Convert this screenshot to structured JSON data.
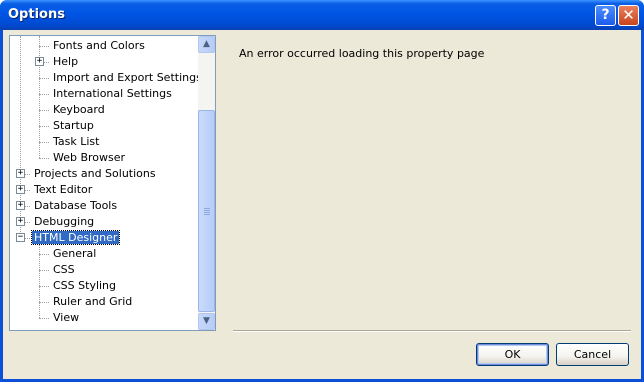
{
  "window": {
    "title": "Options",
    "help_glyph": "?",
    "close_glyph": "✕"
  },
  "tree": {
    "items": [
      {
        "label": "Fonts and Colors",
        "level": 2,
        "expander": null
      },
      {
        "label": "Help",
        "level": 2,
        "expander": "+"
      },
      {
        "label": "Import and Export Settings",
        "level": 2,
        "expander": null
      },
      {
        "label": "International Settings",
        "level": 2,
        "expander": null
      },
      {
        "label": "Keyboard",
        "level": 2,
        "expander": null
      },
      {
        "label": "Startup",
        "level": 2,
        "expander": null
      },
      {
        "label": "Task List",
        "level": 2,
        "expander": null
      },
      {
        "label": "Web Browser",
        "level": 2,
        "expander": null
      },
      {
        "label": "Projects and Solutions",
        "level": 1,
        "expander": "+"
      },
      {
        "label": "Text Editor",
        "level": 1,
        "expander": "+"
      },
      {
        "label": "Database Tools",
        "level": 1,
        "expander": "+"
      },
      {
        "label": "Debugging",
        "level": 1,
        "expander": "+"
      },
      {
        "label": "HTML Designer",
        "level": 1,
        "expander": "−",
        "selected": true
      },
      {
        "label": "General",
        "level": 2,
        "expander": null
      },
      {
        "label": "CSS",
        "level": 2,
        "expander": null
      },
      {
        "label": "CSS Styling",
        "level": 2,
        "expander": null
      },
      {
        "label": "Ruler and Grid",
        "level": 2,
        "expander": null
      },
      {
        "label": "View",
        "level": 2,
        "expander": null
      }
    ]
  },
  "scrollbar": {
    "up_glyph": "▲",
    "down_glyph": "▼"
  },
  "content": {
    "message": "An error occurred loading this property page"
  },
  "buttons": {
    "ok": "OK",
    "cancel": "Cancel"
  },
  "colors": {
    "titlebar": "#0055e5",
    "selection": "#316ac5",
    "dialog_bg": "#ece9d8"
  }
}
